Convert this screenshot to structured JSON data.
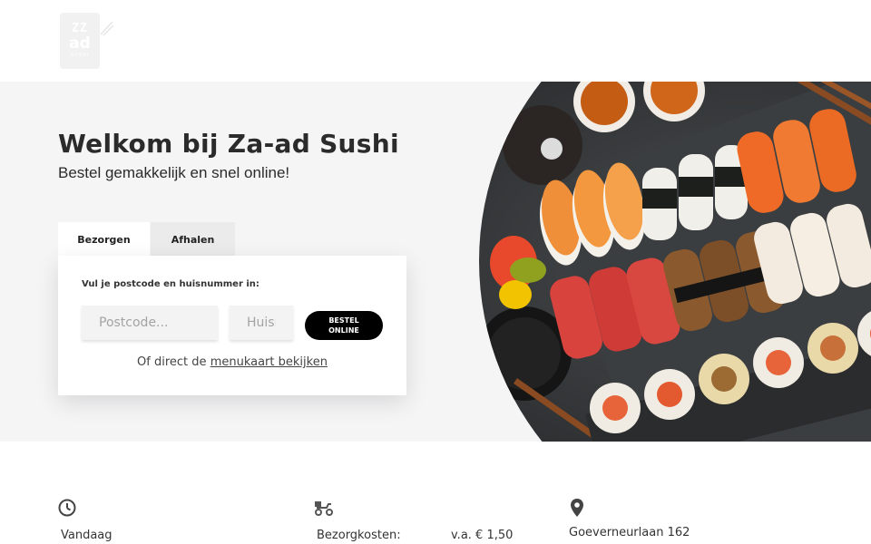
{
  "brand": {
    "logo_line1": "ZZ",
    "logo_line2": "ad",
    "logo_line3": "SUSHI"
  },
  "hero": {
    "title": "Welkom bij Za-ad Sushi",
    "subtitle": "Bestel gemakkelijk en snel online!"
  },
  "tabs": [
    {
      "label": "Bezorgen",
      "active": true
    },
    {
      "label": "Afhalen",
      "active": false
    }
  ],
  "order_form": {
    "label": "Vul je postcode en huisnummer in:",
    "postcode_placeholder": "Postcode...",
    "huis_placeholder": "Huisnr.",
    "postcode_value": "",
    "huis_value": "",
    "submit_label": "BESTEL ONLINE",
    "alt_prefix": "Of direct de",
    "alt_link": "menukaart bekijken"
  },
  "info": {
    "hours": {
      "icon": "clock-icon",
      "label": "Vandaag"
    },
    "delivery": {
      "icon": "scooter-icon",
      "label": "Bezorgkosten:",
      "value": "v.a. € 1,50"
    },
    "address": {
      "icon": "location-pin-icon",
      "street": "Goeverneurlaan 162"
    }
  },
  "colors": {
    "hero_bg": "#f5f5f6",
    "button_bg": "#000000",
    "text": "#2b2b2b"
  }
}
